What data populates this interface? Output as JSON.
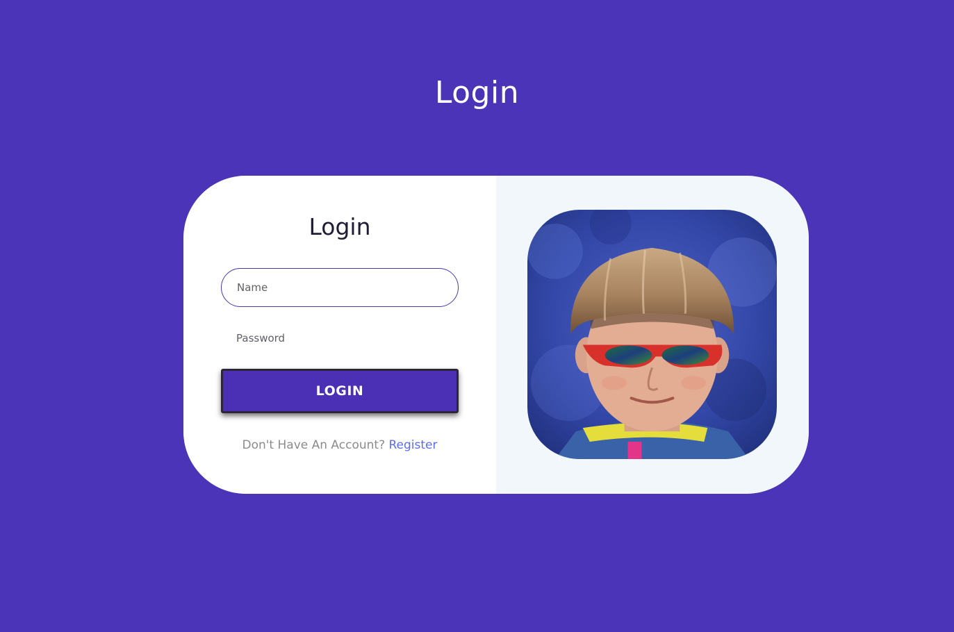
{
  "page": {
    "title": "Login"
  },
  "form": {
    "title": "Login",
    "name_placeholder": "Name",
    "password_placeholder": "Password",
    "submit_label": "LOGIN",
    "no_account_text": "Don't Have An Account?",
    "register_label": "Register"
  },
  "image": {
    "alt": "Boy with bowl haircut and red sunglasses"
  },
  "colors": {
    "background": "#4b34b7",
    "button": "#4b2fb5",
    "link": "#5b6cf0",
    "image_panel": "#f2f7fb"
  }
}
